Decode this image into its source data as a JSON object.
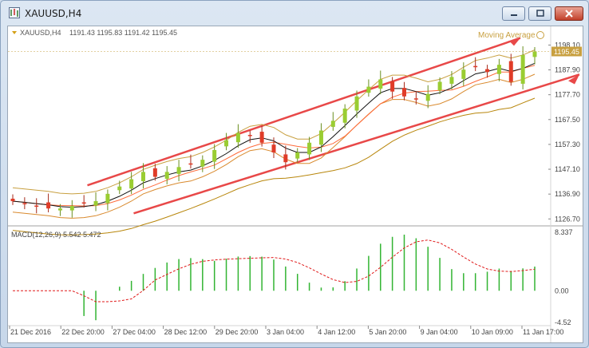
{
  "window": {
    "title": "XAUUSD,H4",
    "controls": [
      "minimize-button",
      "maximize-button",
      "close-button"
    ]
  },
  "chart_header": {
    "label": "XAUUSD,H4",
    "ohlc": "1191.43 1195.83 1191.42 1195.45",
    "indicator_label": "Moving Average"
  },
  "macd": {
    "label": "MACD(12,26,9) 5.542 5.472"
  },
  "colors": {
    "bull_candle": "#9acd32",
    "bear_candle": "#e03c28",
    "macd_hist": "#32b432",
    "macd_signal": "#e01818",
    "channel": "#e84848",
    "envelope": "#b8860b"
  },
  "chart_data": [
    {
      "type": "candlestick",
      "symbol": "XAUUSD",
      "timeframe": "H4",
      "price_labels": [
        "1198.10",
        "1187.90",
        "1177.70",
        "1167.50",
        "1157.30",
        "1147.10",
        "1136.90",
        "1126.70"
      ],
      "current_price_label": "1195.45",
      "ylim": [
        1124.5,
        1202.5
      ],
      "x_labels": [
        "21 Dec 2016",
        "22 Dec 20:00",
        "27 Dec 04:00",
        "28 Dec 12:00",
        "29 Dec 20:00",
        "3 Jan 04:00",
        "4 Jan 12:00",
        "5 Jan 20:00",
        "9 Jan 04:00",
        "10 Jan 09:00",
        "11 Jan 17:00"
      ],
      "close_trend": [
        1134,
        1133,
        1132,
        1131,
        1131,
        1132,
        1133,
        1134,
        1137,
        1140,
        1143,
        1146,
        1144,
        1146,
        1148,
        1149,
        1151,
        1155,
        1159,
        1162,
        1161,
        1158,
        1154,
        1150,
        1154,
        1158,
        1163,
        1167,
        1172,
        1177,
        1181,
        1184,
        1179,
        1177,
        1176,
        1178,
        1183,
        1185,
        1188,
        1189,
        1187,
        1190,
        1183,
        1194,
        1195.45
      ]
    },
    {
      "type": "bar",
      "name": "MACD(12,26,9)",
      "value_labels": [
        "8.337",
        "0.00",
        "-4.52"
      ],
      "ylim": [
        -4.52,
        8.337
      ]
    }
  ]
}
